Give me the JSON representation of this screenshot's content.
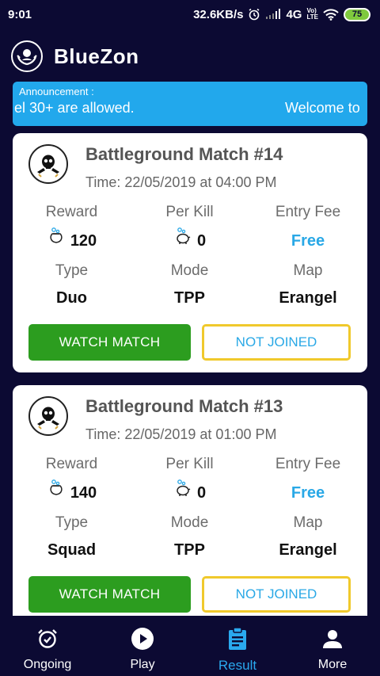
{
  "status_bar": {
    "time": "9:01",
    "net_speed": "32.6KB/s",
    "network": "4G",
    "volte_top": "Vo)",
    "volte_bottom": "LTE",
    "battery": "75"
  },
  "app": {
    "title": "BlueZon",
    "logo_icon": "person-hands-icon"
  },
  "announcement": {
    "label": "Announcement :",
    "text_left": "el 30+ are allowed.",
    "text_right": "Welcome to"
  },
  "matches": [
    {
      "title": "Battleground Match #14",
      "time": "Time: 22/05/2019 at 04:00 PM",
      "reward_label": "Reward",
      "reward": "120",
      "per_kill_label": "Per Kill",
      "per_kill": "0",
      "entry_fee_label": "Entry Fee",
      "entry_fee": "Free",
      "type_label": "Type",
      "type": "Duo",
      "mode_label": "Mode",
      "mode": "TPP",
      "map_label": "Map",
      "map": "Erangel",
      "watch_label": "WATCH MATCH",
      "status_label": "NOT JOINED"
    },
    {
      "title": "Battleground Match #13",
      "time": "Time: 22/05/2019 at 01:00 PM",
      "reward_label": "Reward",
      "reward": "140",
      "per_kill_label": "Per Kill",
      "per_kill": "0",
      "entry_fee_label": "Entry Fee",
      "entry_fee": "Free",
      "type_label": "Type",
      "type": "Squad",
      "mode_label": "Mode",
      "mode": "TPP",
      "map_label": "Map",
      "map": "Erangel",
      "watch_label": "WATCH MATCH",
      "status_label": "NOT JOINED"
    }
  ],
  "nav": [
    {
      "label": "Ongoing",
      "icon": "alarm-check-icon"
    },
    {
      "label": "Play",
      "icon": "play-circle-icon"
    },
    {
      "label": "Result",
      "icon": "clipboard-icon",
      "active": true
    },
    {
      "label": "More",
      "icon": "person-icon"
    }
  ],
  "colors": {
    "background": "#0c0a33",
    "accent": "#22a8ec",
    "watch_button": "#2c9d1f",
    "status_border": "#f0c92c",
    "free_text": "#29a8e6",
    "battery": "#7fc93e"
  }
}
